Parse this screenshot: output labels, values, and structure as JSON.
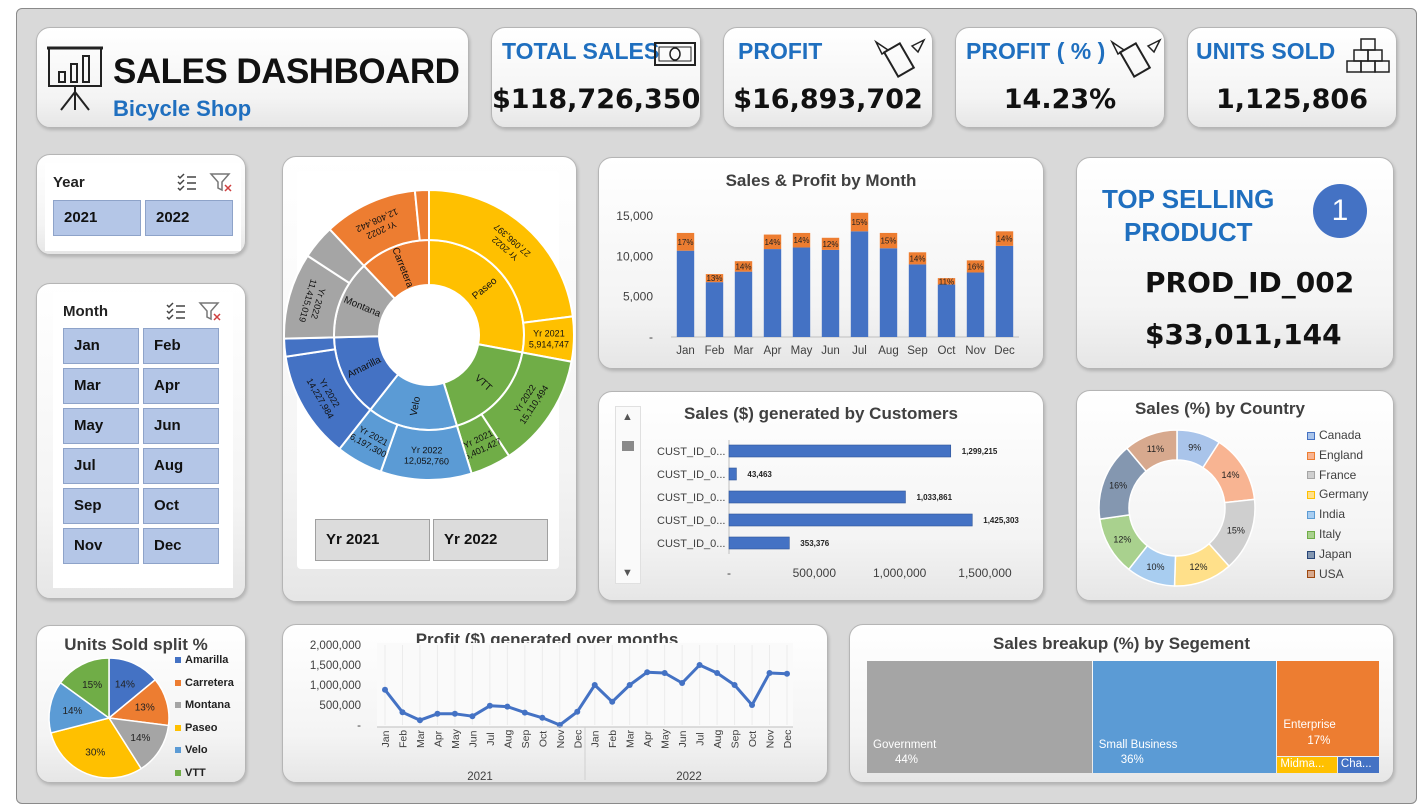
{
  "header": {
    "title": "SALES DASHBOARD",
    "subtitle": "Bicycle Shop",
    "icon": "presentation-chart-icon"
  },
  "kpis": {
    "total_sales": {
      "label": "TOTAL SALES",
      "value": "$118,726,350",
      "icon": "cash-icon"
    },
    "profit": {
      "label": "PROFIT",
      "value": "$16,893,702",
      "icon": "flying-money-icon"
    },
    "profit_pct": {
      "label": "PROFIT ( % )",
      "value": "14.23%",
      "icon": "flying-money-icon"
    },
    "units_sold": {
      "label": "UNITS SOLD",
      "value": "1,125,806",
      "icon": "boxes-icon"
    }
  },
  "year_slicer": {
    "label": "Year",
    "items": [
      "2021",
      "2022"
    ]
  },
  "month_slicer": {
    "label": "Month",
    "items": [
      "Jan",
      "Feb",
      "Mar",
      "Apr",
      "May",
      "Jun",
      "Jul",
      "Aug",
      "Sep",
      "Oct",
      "Nov",
      "Dec"
    ]
  },
  "sunburst": {
    "buttons": [
      "Yr 2021",
      "Yr 2022"
    ],
    "inner": [
      {
        "name": "Paseo",
        "share": 0.2795,
        "color": "#ffc000"
      },
      {
        "name": "VTT",
        "share": 0.173,
        "color": "#70ad47"
      },
      {
        "name": "Velo",
        "share": 0.1535,
        "color": "#5b9bd5"
      },
      {
        "name": "Amarilla",
        "share": 0.14,
        "color": "#4472c4"
      },
      {
        "name": "Montana",
        "share": 0.134,
        "color": "#a5a5a5"
      },
      {
        "name": "Carretera",
        "share": 0.12,
        "color": "#ed7d31"
      }
    ],
    "outer": [
      {
        "label": "Yr 2022",
        "value": "27,096,397",
        "share": 0.2295,
        "color": "#ffc000"
      },
      {
        "label": "Yr 2021",
        "value": "5,914,747",
        "share": 0.05,
        "color": "#ffc000"
      },
      {
        "label": "Yr 2022",
        "value": "15,110,494",
        "share": 0.1275,
        "color": "#70ad47"
      },
      {
        "label": "Yr 2021",
        "value": "5,401,427",
        "share": 0.0455,
        "color": "#70ad47"
      },
      {
        "label": "Yr 2022",
        "value": "12,052,760",
        "share": 0.1015,
        "color": "#5b9bd5"
      },
      {
        "label": "Yr 2021",
        "value": "6,197,300",
        "share": 0.052,
        "color": "#5b9bd5"
      },
      {
        "label": "Yr 2022",
        "value": "14,227,984",
        "share": 0.12,
        "color": "#4472c4"
      },
      {
        "label": "",
        "value": "",
        "share": 0.02,
        "color": "#4472c4"
      },
      {
        "label": "Yr 2022",
        "value": "11,415,019",
        "share": 0.096,
        "color": "#a5a5a5"
      },
      {
        "label": "",
        "value": "",
        "share": 0.038,
        "color": "#a5a5a5"
      },
      {
        "label": "Yr 2022",
        "value": "12,408,442",
        "share": 0.1045,
        "color": "#ed7d31"
      },
      {
        "label": "",
        "value": "",
        "share": 0.0155,
        "color": "#ed7d31"
      }
    ]
  },
  "top_product": {
    "title_line1": "TOP SELLING",
    "title_line2": "PRODUCT",
    "rank": "1",
    "product_id": "PROD_ID_002",
    "sales": "$33,011,144"
  },
  "chart_data": [
    {
      "type": "bar",
      "title": "Sales & Profit by Month",
      "categories": [
        "Jan",
        "Feb",
        "Mar",
        "Apr",
        "May",
        "Jun",
        "Jul",
        "Aug",
        "Sep",
        "Oct",
        "Nov",
        "Dec"
      ],
      "series": [
        {
          "values": [
            10700,
            6800,
            8100,
            10900,
            11100,
            10800,
            13100,
            11000,
            9000,
            6500,
            8000,
            11300
          ],
          "color": "#4472c4"
        },
        {
          "values": [
            2200,
            1000,
            1300,
            1800,
            1800,
            1500,
            2300,
            1900,
            1500,
            800,
            1500,
            1800
          ],
          "color": "#ed7d31"
        }
      ],
      "data_labels": [
        "17%",
        "13%",
        "14%",
        "14%",
        "14%",
        "12%",
        "15%",
        "15%",
        "14%",
        "11%",
        "16%",
        "14%"
      ],
      "yticks": [
        "15,000",
        "10,000",
        "5,000",
        "-"
      ],
      "ylim": [
        0,
        15000
      ]
    },
    {
      "type": "bar",
      "orientation": "horizontal",
      "title": "Sales ($) generated by Customers",
      "categories": [
        "CUST_ID_0...",
        "CUST_ID_0...",
        "CUST_ID_0...",
        "CUST_ID_0...",
        "CUST_ID_0..."
      ],
      "values": [
        1299215,
        43463,
        1033861,
        1425303,
        353376
      ],
      "value_labels": [
        "1,299,215",
        "43,463",
        "1,033,861",
        "1,425,303",
        "353,376"
      ],
      "xticks": [
        "-",
        "500,000",
        "1,000,000",
        "1,500,000"
      ],
      "xlim": [
        0,
        1500000
      ]
    },
    {
      "type": "pie",
      "subtype": "doughnut",
      "title": "Sales (%) by Country",
      "categories": [
        "Canada",
        "England",
        "France",
        "Germany",
        "India",
        "Italy",
        "Japan",
        "USA"
      ],
      "values": [
        9,
        14,
        15,
        12,
        10,
        12,
        16,
        11
      ],
      "labels": [
        "9%",
        "14%",
        "15%",
        "12%",
        "10%",
        "12%",
        "16%",
        "11%"
      ],
      "colors": [
        "#a9c4ea",
        "#f8b492",
        "#cfcfcf",
        "#ffe08a",
        "#a8cdf0",
        "#a9d18e",
        "#8497b0",
        "#d7a98e"
      ],
      "legend": "right"
    },
    {
      "type": "pie",
      "title": "Units Sold split %",
      "categories": [
        "Amarilla",
        "Carretera",
        "Montana",
        "Paseo",
        "Velo",
        "VTT"
      ],
      "values": [
        14,
        13,
        14,
        30,
        14,
        15
      ],
      "labels": [
        "14%",
        "13%",
        "14%",
        "30%",
        "14%",
        "15%"
      ],
      "colors": [
        "#4472c4",
        "#ed7d31",
        "#a5a5a5",
        "#ffc000",
        "#5b9bd5",
        "#70ad47"
      ],
      "legend": "right"
    },
    {
      "type": "line",
      "title": "Profit ($) generated over months",
      "x": [
        "Jan",
        "Feb",
        "Mar",
        "Apr",
        "May",
        "Jun",
        "Jul",
        "Aug",
        "Sep",
        "Oct",
        "Nov",
        "Dec",
        "Jan",
        "Feb",
        "Mar",
        "Apr",
        "May",
        "Jun",
        "Jul",
        "Aug",
        "Sep",
        "Oct",
        "Nov",
        "Dec"
      ],
      "groups": [
        "2021",
        "2022"
      ],
      "values": [
        880000,
        320000,
        120000,
        280000,
        280000,
        220000,
        480000,
        460000,
        310000,
        180000,
        0,
        330000,
        1000000,
        580000,
        1000000,
        1320000,
        1300000,
        1050000,
        1500000,
        1300000,
        1000000,
        500000,
        1300000,
        1280000
      ],
      "yticks": [
        "2,000,000",
        "1,500,000",
        "1,000,000",
        "500,000",
        "-"
      ],
      "ylim": [
        0,
        2000000
      ],
      "color": "#4472c4"
    },
    {
      "type": "treemap",
      "title": "Sales breakup (%) by Segement",
      "categories": [
        "Government",
        "Small Business",
        "Enterprise",
        "Midma...",
        "Cha..."
      ],
      "values": [
        44,
        36,
        17,
        2,
        1
      ],
      "labels": [
        "44%",
        "36%",
        "17%",
        "",
        ""
      ],
      "colors": [
        "#a5a5a5",
        "#5b9bd5",
        "#ed7d31",
        "#ffc000",
        "#4472c4"
      ]
    }
  ]
}
